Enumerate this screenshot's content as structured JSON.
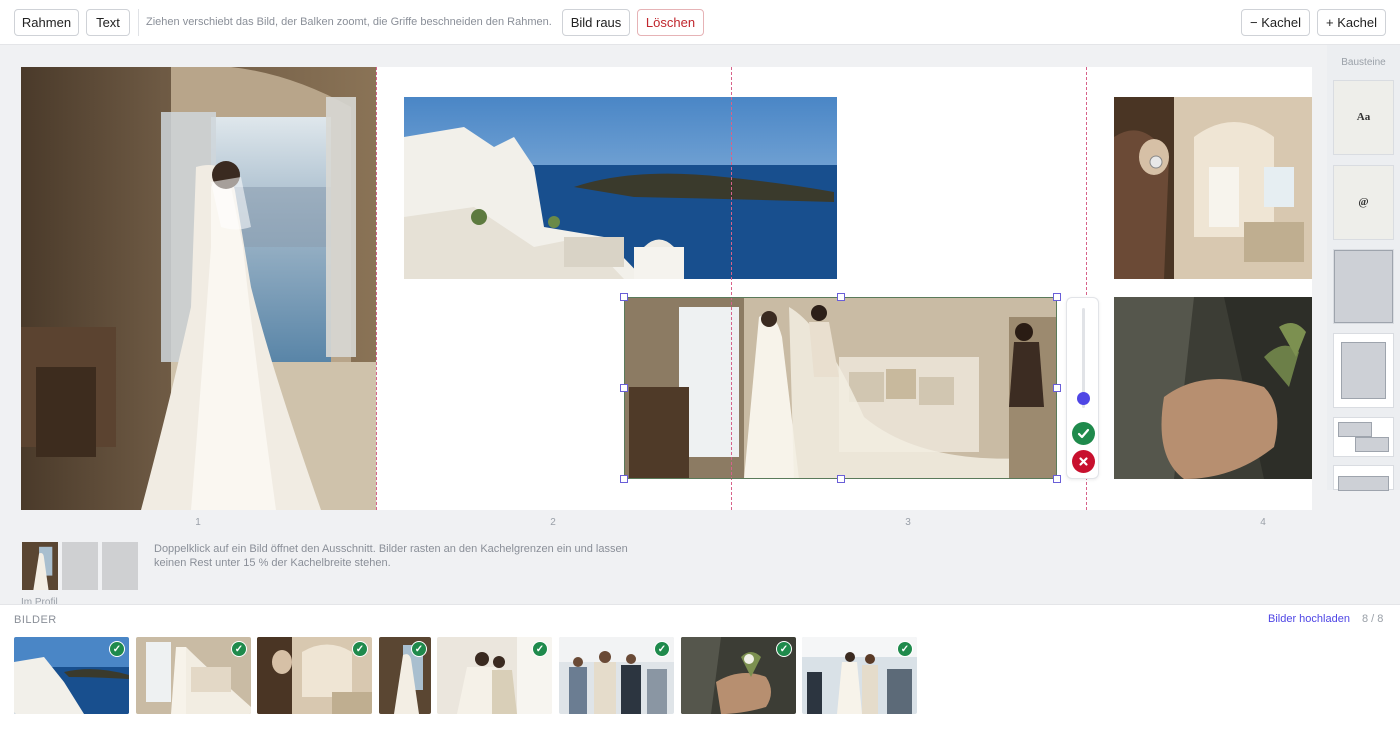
{
  "toolbar": {
    "frame_label": "Rahmen",
    "text_label": "Text",
    "hint": "Ziehen verschiebt das Bild, der Balken zoomt, die Griffe beschneiden den Rahmen.",
    "remove_image_label": "Bild raus",
    "delete_label": "Löschen",
    "tile_minus_label": "− Kachel",
    "tile_plus_label": "+ Kachel"
  },
  "canvas": {
    "page_numbers": [
      "1",
      "2",
      "3",
      "4"
    ],
    "photos": [
      "bride-at-window",
      "santorini-coast",
      "bride-veil-room",
      "earring-closeup",
      "hand-boutonniere"
    ]
  },
  "zoom": {
    "level": 0.1,
    "confirm_icon": "check-icon",
    "cancel_icon": "x-icon"
  },
  "sidebar": {
    "title": "Bausteine",
    "blocks": [
      {
        "name": "text-block",
        "label": "Aa"
      },
      {
        "name": "email-block",
        "label": "@"
      },
      {
        "name": "tall-image-block",
        "label": ""
      },
      {
        "name": "framed-image-block",
        "label": ""
      },
      {
        "name": "overlap-image-block",
        "label": ""
      },
      {
        "name": "wide-image-block",
        "label": ""
      }
    ]
  },
  "profile": {
    "label": "Im Profil",
    "info": "Doppelklick auf ein Bild öffnet den Ausschnitt. Bilder rasten an den Kachelgrenzen ein und lassen keinen Rest unter 15 % der Kachelbreite stehen."
  },
  "tray": {
    "title": "BILDER",
    "upload_label": "Bilder hochladen",
    "count": "8 / 8",
    "check_glyph": "✓",
    "images": [
      "santorini-coast",
      "bride-veil-room",
      "earring-closeup",
      "bride-at-window",
      "couple-seated",
      "groom-guests",
      "hand-boutonniere",
      "couple-walking"
    ]
  },
  "colors": {
    "accent": "#4f46e5",
    "success": "#1f8a4c",
    "danger": "#c8102e",
    "guide": "#d7628a"
  }
}
